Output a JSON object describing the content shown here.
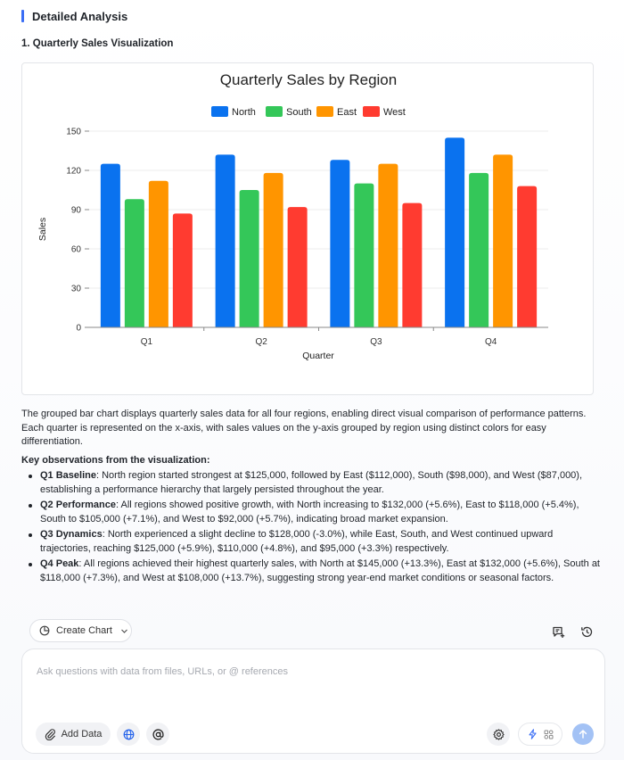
{
  "section": {
    "title": "Detailed Analysis"
  },
  "subsection": {
    "title": "1. Quarterly Sales Visualization"
  },
  "chart_data": {
    "type": "bar",
    "title": "Quarterly Sales by Region",
    "xlabel": "Quarter",
    "ylabel": "Sales",
    "categories": [
      "Q1",
      "Q2",
      "Q3",
      "Q4"
    ],
    "ylim": [
      0,
      150
    ],
    "yticks": [
      0,
      30,
      60,
      90,
      120,
      150
    ],
    "grid": true,
    "legend_position": "top",
    "series": [
      {
        "name": "North",
        "color": "#0a72ef",
        "values": [
          125,
          132,
          128,
          145
        ]
      },
      {
        "name": "South",
        "color": "#34c759",
        "values": [
          98,
          105,
          110,
          118
        ]
      },
      {
        "name": "East",
        "color": "#ff9500",
        "values": [
          112,
          118,
          125,
          132
        ]
      },
      {
        "name": "West",
        "color": "#ff3b30",
        "values": [
          87,
          92,
          95,
          108
        ]
      }
    ]
  },
  "analysis": {
    "paragraph": "The grouped bar chart displays quarterly sales data for all four regions, enabling direct visual comparison of performance patterns. Each quarter is represented on the x-axis, with sales values on the y-axis grouped by region using distinct colors for easy differentiation.",
    "observations_heading": "Key observations from the visualization:",
    "observations": [
      {
        "label": "Q1 Baseline",
        "text": ": North region started strongest at $125,000, followed by East ($112,000), South ($98,000), and West ($87,000), establishing a performance hierarchy that largely persisted throughout the year."
      },
      {
        "label": "Q2 Performance",
        "text": ": All regions showed positive growth, with North increasing to $132,000 (+5.6%), East to $118,000 (+5.4%), South to $105,000 (+7.1%), and West to $92,000 (+5.7%), indicating broad market expansion."
      },
      {
        "label": "Q3 Dynamics",
        "text": ": North experienced a slight decline to $128,000 (-3.0%), while East, South, and West continued upward trajectories, reaching $125,000 (+5.9%), $110,000 (+4.8%), and $95,000 (+3.3%) respectively."
      },
      {
        "label": "Q4 Peak",
        "text": ": All regions achieved their highest quarterly sales, with North at $145,000 (+13.3%), East at $132,000 (+5.6%), South at $118,000 (+7.3%), and West at $108,000 (+13.7%), suggesting strong year-end market conditions or seasonal factors."
      }
    ]
  },
  "toolbar": {
    "create_chart_label": "Create Chart"
  },
  "composer": {
    "placeholder": "Ask questions with data from files, URLs, or @ references",
    "add_data_label": "Add Data"
  },
  "colors": {
    "accent": "#3b6ef5",
    "send_disabled": "#a3c2f5"
  },
  "icons": {
    "create_chart": "pie-chart-icon",
    "dropdown": "chevron-down-icon",
    "new_chat": "message-plus-icon",
    "history": "history-icon",
    "add_data": "paperclip-icon",
    "web": "globe-icon",
    "mention": "at-sign-icon",
    "settings": "gear-icon",
    "fast_mode": "lightning-icon",
    "agent_mode": "grid-icon",
    "send": "arrow-up-icon"
  }
}
